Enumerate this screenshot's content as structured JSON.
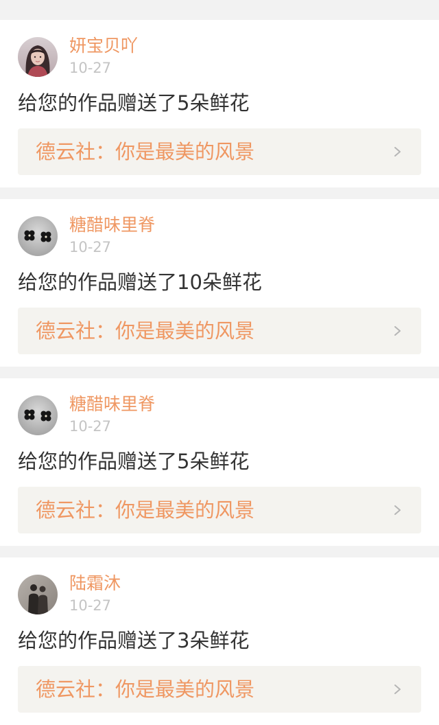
{
  "feed": [
    {
      "username": "妍宝贝吖",
      "date": "10-27",
      "message": "给您的作品赠送了5朵鲜花",
      "work_title": "德云社：你是最美的风景",
      "avatar_icon": "girl-portrait-avatar"
    },
    {
      "username": "糖醋味里脊",
      "date": "10-27",
      "message": "给您的作品赠送了10朵鲜花",
      "work_title": "德云社：你是最美的风景",
      "avatar_icon": "black-flower-earrings-avatar"
    },
    {
      "username": "糖醋味里脊",
      "date": "10-27",
      "message": "给您的作品赠送了5朵鲜花",
      "work_title": "德云社：你是最美的风景",
      "avatar_icon": "black-flower-earrings-avatar"
    },
    {
      "username": "陆霜沐",
      "date": "10-27",
      "message": "给您的作品赠送了3朵鲜花",
      "work_title": "德云社：你是最美的风景",
      "avatar_icon": "two-people-silhouette-avatar"
    }
  ],
  "colors": {
    "accent": "#ef9762",
    "date_gray": "#c4c4c4",
    "text": "#333333",
    "link_bg": "#f4f3ef",
    "page_bg": "#f2f2f2"
  }
}
